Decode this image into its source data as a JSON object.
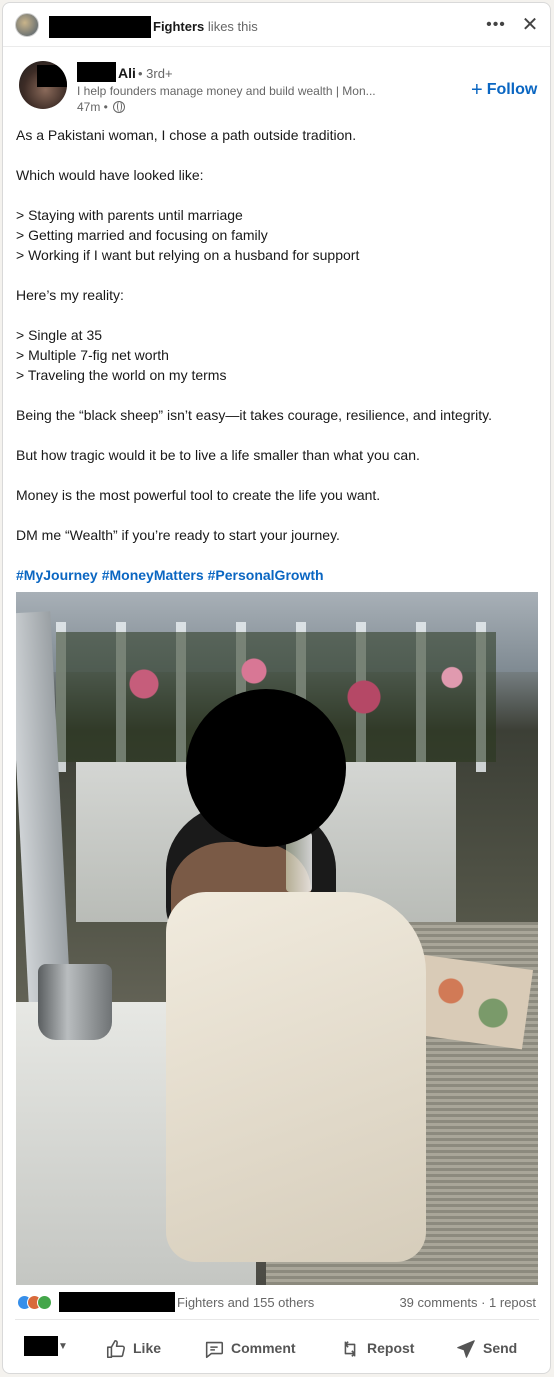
{
  "social_bar": {
    "actor": "Fighters",
    "action_text": "likes this"
  },
  "author": {
    "name": "Ali",
    "degree": "• 3rd+",
    "headline": "I help founders manage money and build wealth | Mon...",
    "time": "47m •",
    "follow_label": "Follow"
  },
  "post": {
    "lines": [
      "As a Pakistani woman, I chose a path outside tradition.",
      "",
      "Which would have looked like:",
      "",
      "> Staying with parents until marriage",
      "> Getting married and focusing on family",
      "> Working if I want but relying on a husband for support",
      "",
      "Here’s my reality:",
      "",
      "> Single at 35",
      "> Multiple 7-fig net worth",
      "> Traveling the world on my terms",
      "",
      "Being the “black sheep” isn’t easy—it takes courage, resilience, and integrity.",
      "",
      "But how tragic would it be to live a life smaller than what you can.",
      "",
      "Money is the most powerful tool to create the life you want.",
      "",
      "DM me “Wealth” if you’re ready to start your journey."
    ],
    "hashtags": [
      "#MyJourney",
      "#MoneyMatters",
      "#PersonalGrowth"
    ]
  },
  "social_counts": {
    "reactions_text": "Fighters and 155 others",
    "comments_text": "39 comments · 1 repost"
  },
  "actions": {
    "like": "Like",
    "comment": "Comment",
    "repost": "Repost",
    "send": "Send"
  },
  "colors": {
    "link_blue": "#0a66c2",
    "like_reaction": "#378fe9",
    "celebrate_reaction": "#d86a3a",
    "support_reaction": "#44a64a"
  }
}
